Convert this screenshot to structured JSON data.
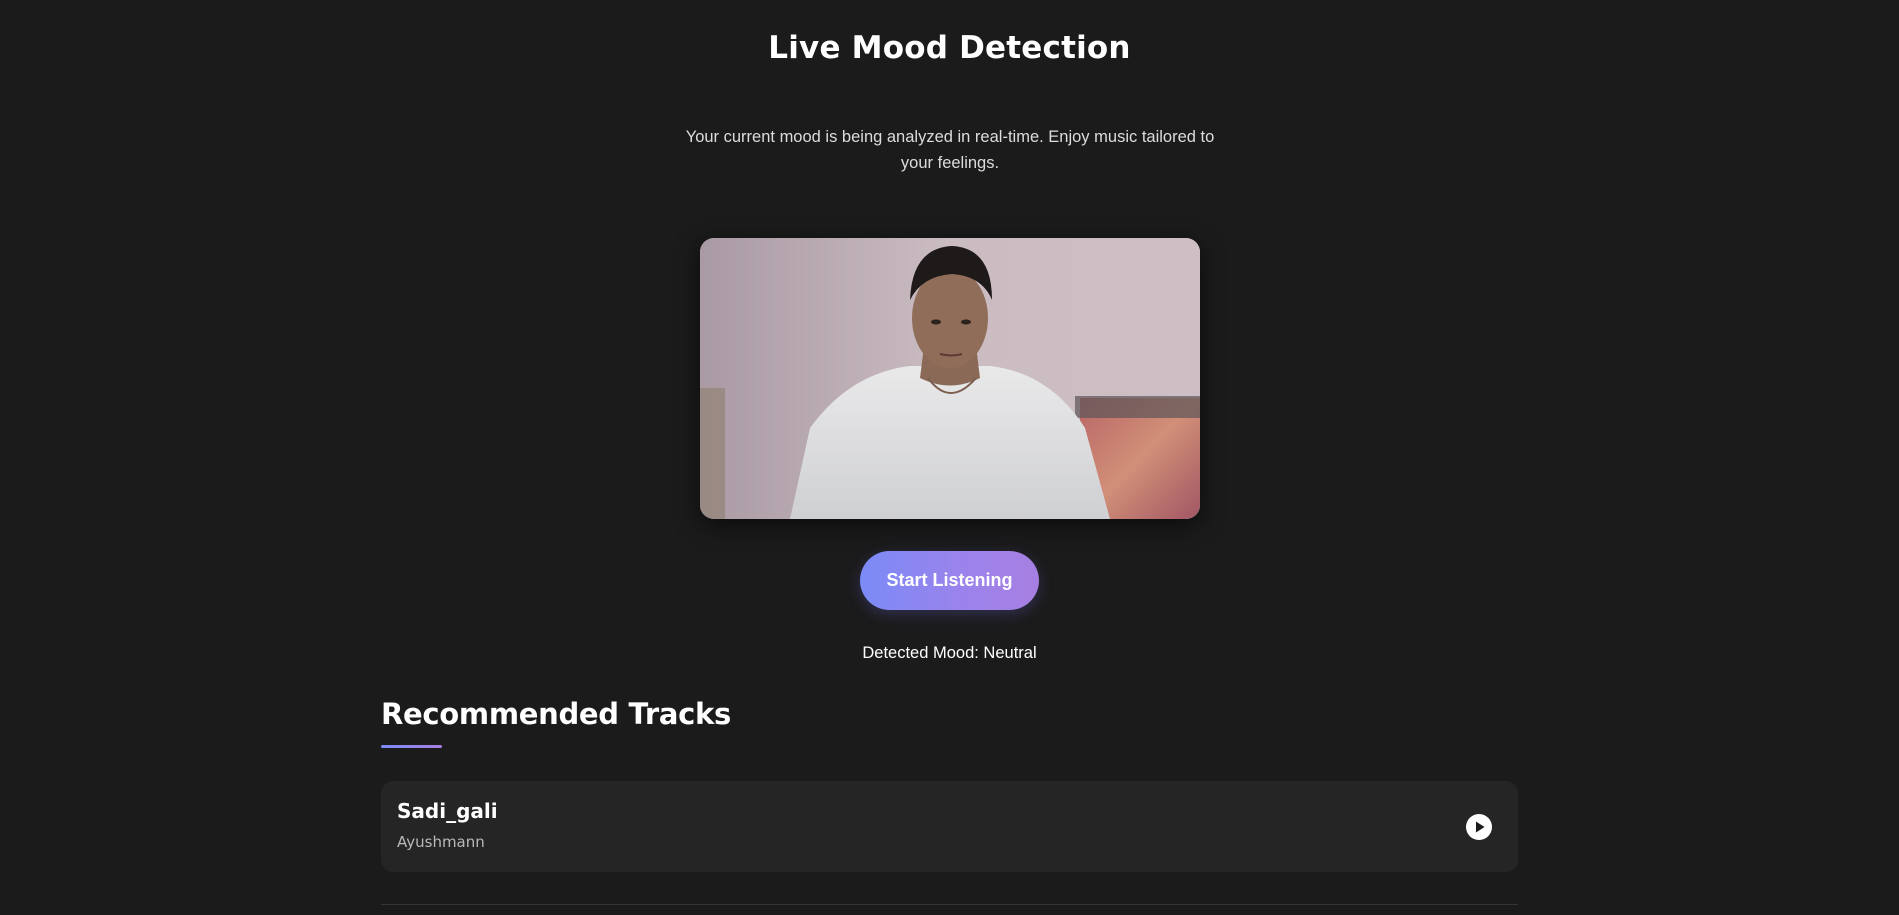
{
  "header": {
    "title": "Live Mood Detection",
    "subtitle": "Your current mood is being analyzed in real-time. Enjoy music tailored to your feelings."
  },
  "camera": {
    "feed_description": "webcam-feed"
  },
  "controls": {
    "start_label": "Start Listening"
  },
  "mood": {
    "text": "Detected Mood: Neutral"
  },
  "recommendations": {
    "heading": "Recommended Tracks",
    "tracks": [
      {
        "title": "Sadi_gali",
        "artist": "Ayushmann",
        "action_icon": "play-icon"
      }
    ]
  },
  "colors": {
    "background": "#1b1b1c",
    "card": "#252526",
    "accent_start": "#7b8bf7",
    "accent_end": "#a77fe1"
  }
}
